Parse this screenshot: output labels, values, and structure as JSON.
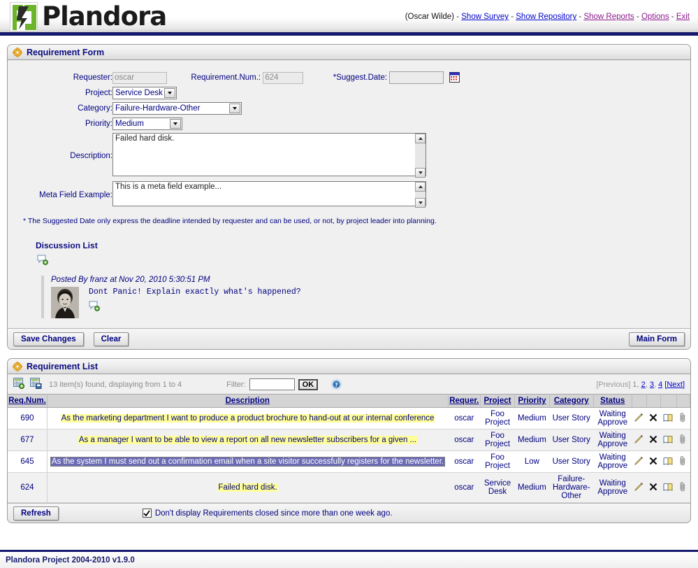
{
  "header": {
    "logo_text": "Plandora",
    "logo_icon": "plandora-logo-icon",
    "user": "(Oscar Wilde)",
    "dash1": "-",
    "dash2": "-",
    "dash3": "-",
    "dash4": "-",
    "dash5": "-",
    "links": [
      {
        "label": "Show Survey",
        "color": "#0000cc"
      },
      {
        "label": "Show Repository",
        "color": "#0000cc"
      },
      {
        "label": "Show Reports",
        "color": "#8b1a8b"
      },
      {
        "label": "Options",
        "color": "#8b1a8b"
      },
      {
        "label": "Exit",
        "color": "#8b1a8b"
      }
    ]
  },
  "form_panel": {
    "title": "Requirement Form",
    "gear_icon": "gear-icon",
    "fields": {
      "requester_label": "Requester:",
      "requester_value": "oscar",
      "reqnum_label": "Requirement.Num.:",
      "reqnum_value": "624",
      "suggestdate_label": "*Suggest.Date:",
      "suggestdate_value": "",
      "calendar_icon": "calendar-icon",
      "project_label": "Project:",
      "project_value": "Service Desk",
      "category_label": "Category:",
      "category_value": "Failure-Hardware-Other",
      "priority_label": "Priority:",
      "priority_value": "Medium",
      "description_label": "Description:",
      "description_value": "Failed hard disk.",
      "meta_label": "Meta Field Example:",
      "meta_value": "This is a meta field example..."
    },
    "note": "* The Suggested Date only express the deadline intended by requester and can be used, or not, by project leader into planning.",
    "discussion": {
      "title": "Discussion List",
      "add_icon": "add-comment-icon",
      "posts": [
        {
          "meta": "Posted By franz at Nov 20, 2010 5:30:51 PM",
          "message": "Dont Panic! Explain exactly what's happened?",
          "avatar_icon": "user-avatar",
          "reply_icon": "add-comment-icon"
        }
      ]
    },
    "buttons": {
      "save": "Save Changes",
      "clear": "Clear",
      "main_form": "Main Form"
    }
  },
  "list_panel": {
    "title": "Requirement List",
    "gear_icon": "gear-icon",
    "toolbar": {
      "new_icon": "new-record-icon",
      "export_icon": "export-record-icon",
      "found_text": "13 item(s) found, displaying from 1 to 4",
      "filter_label": "Filter:",
      "filter_value": "",
      "ok_label": "OK",
      "help_icon": "help-icon"
    },
    "pager": {
      "previous": "[Previous]",
      "pages": [
        "1",
        "2",
        "3",
        "4"
      ],
      "next": "[Next]",
      "comma": ","
    },
    "columns": [
      "Req.Num.",
      "Description",
      "Requer.",
      "Project",
      "Priority",
      "Category",
      "Status"
    ],
    "rows": [
      {
        "num": "690",
        "description": "As the marketing department I want to produce a product brochure to hand-out at our internal conference",
        "highlight": "yellow",
        "requester": "oscar",
        "project": "Foo Project",
        "priority": "Medium",
        "category": "User Story",
        "status": "Waiting Approve"
      },
      {
        "num": "677",
        "description": "As a manager I want to be able to view a report on all new newsletter subscribers for a given ...",
        "highlight": "yellow",
        "requester": "oscar",
        "project": "Foo Project",
        "priority": "Medium",
        "category": "User Story",
        "status": "Waiting Approve"
      },
      {
        "num": "645",
        "description": "As the system I must send out a confirmation email when a site visitor successfully registers for the newsletter.",
        "highlight": "selected",
        "requester": "oscar",
        "project": "Foo Project",
        "priority": "Low",
        "category": "User Story",
        "status": "Waiting Approve"
      },
      {
        "num": "624",
        "description": "Failed hard disk.",
        "highlight": "yellow",
        "requester": "oscar",
        "project": "Service Desk",
        "priority": "Medium",
        "category": "Failure-Hardware-Other",
        "status": "Waiting Approve"
      }
    ],
    "row_actions": {
      "edit_icon": "pencil-edit-icon",
      "delete_icon": "close-delete-icon",
      "copy_icon": "copy-icon",
      "attach_icon": "paperclip-attach-icon"
    },
    "footer": {
      "refresh": "Refresh",
      "checkbox_checked": true,
      "checkbox_label": "Don't display Requirements closed since more than one week ago."
    }
  },
  "footer": {
    "text": "Plandora Project 2004-2010 v1.9.0"
  }
}
